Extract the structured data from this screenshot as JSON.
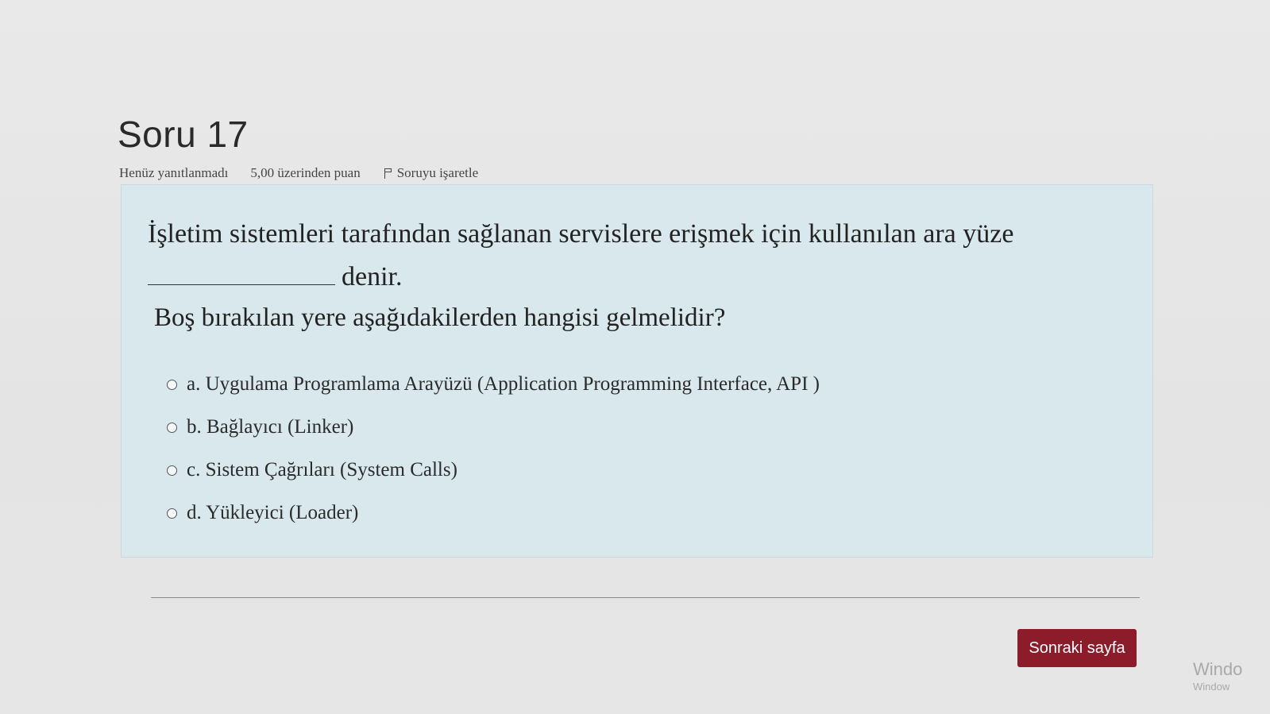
{
  "question": {
    "title": "Soru 17",
    "status": "Henüz yanıtlanmadı",
    "score": "5,00 üzerinden puan",
    "flag_label": "Soruyu işaretle",
    "text_line1": "İşletim sistemleri tarafından sağlanan servislere erişmek için kullanılan ara yüze",
    "text_line2": "denir.",
    "prompt": "Boş bırakılan yere aşağıdakilerden hangisi gelmelidir?",
    "options": [
      {
        "label": "a. Uygulama Programlama Arayüzü (Application Programming Interface, API )"
      },
      {
        "label": "b. Bağlayıcı (Linker)"
      },
      {
        "label": "c. Sistem Çağrıları (System Calls)"
      },
      {
        "label": "d. Yükleyici (Loader)"
      }
    ]
  },
  "navigation": {
    "next_label": "Sonraki sayfa"
  },
  "watermark": {
    "line1": "Windo",
    "line2": "Window"
  },
  "colors": {
    "content_background": "#d9e8ec",
    "next_button": "#8c1c2a"
  },
  "icons": {
    "flag": "flag-icon",
    "radio": "radio-unchecked-icon"
  }
}
